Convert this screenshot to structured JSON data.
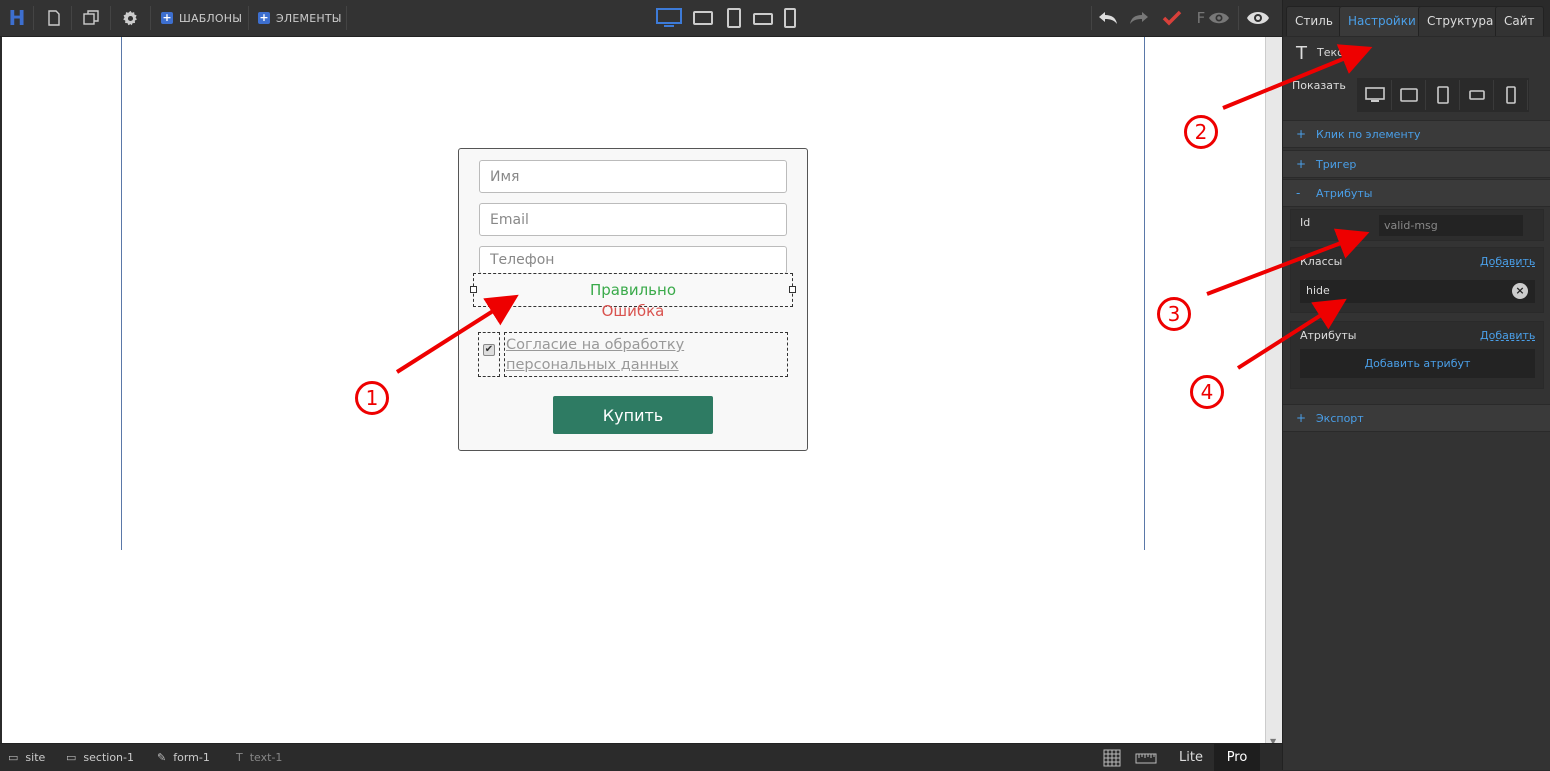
{
  "toolbar": {
    "logo": "H",
    "templates_label": "ШАБЛОНЫ",
    "elements_label": "ЭЛЕМЕНТЫ",
    "f_label": "F"
  },
  "form": {
    "name_placeholder": "Имя",
    "email_placeholder": "Email",
    "phone_placeholder": "Телефон",
    "valid_text": "Правильно",
    "error_text": "Ошибка",
    "consent_text": "Согласие на обработку персональных данных",
    "buy_label": "Купить",
    "checkbox_mark": "✔"
  },
  "statusbar": {
    "crumbs": [
      "site",
      "section-1",
      "form-1",
      "text-1"
    ],
    "lite": "Lite",
    "pro": "Pro"
  },
  "panel": {
    "tabs": [
      "Стиль",
      "Настройки",
      "Структура",
      "Сайт"
    ],
    "element_type": "Текст",
    "show_label": "Показать",
    "sections": {
      "click": "Клик по элементу",
      "trigger": "Тригер",
      "attributes": "Атрибуты",
      "export": "Экспорт"
    },
    "id_label": "Id",
    "id_value": "valid-msg",
    "classes_label": "Классы",
    "classes_add": "Добавить",
    "class_value": "hide",
    "attrs_label": "Атрибуты",
    "attrs_add": "Добавить",
    "add_attr_button": "Добавить атрибут"
  },
  "annotations": [
    "1",
    "2",
    "3",
    "4"
  ],
  "colors": {
    "accent": "#4a9fe8",
    "valid": "#3aaa4a",
    "error": "#d9534f",
    "button": "#2e7b63",
    "annotation": "#ee0000"
  }
}
